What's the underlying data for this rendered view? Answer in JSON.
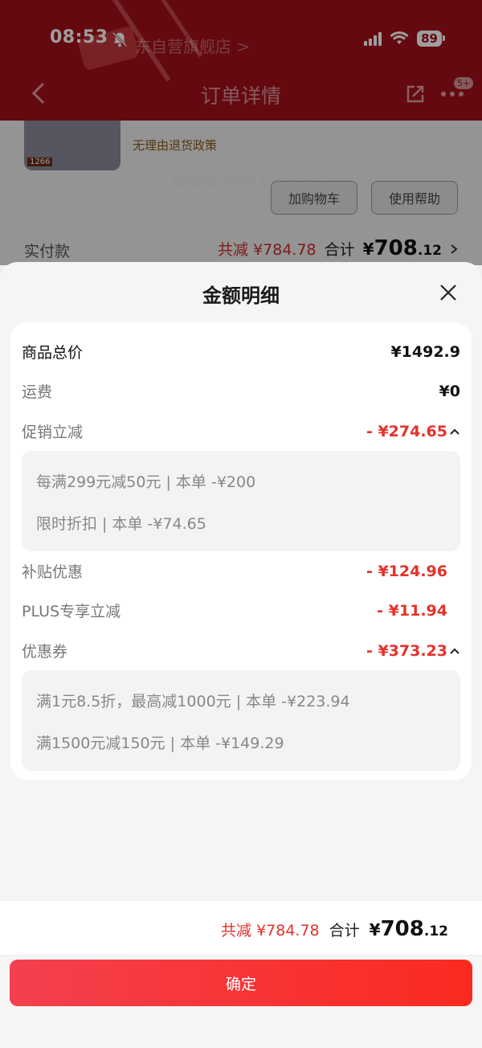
{
  "status_bar": {
    "time": "08:53",
    "battery": "89"
  },
  "header": {
    "store_name": "东自营旗舰店 >",
    "title": "订单详情",
    "badge": "5+"
  },
  "order": {
    "return_policy": "无理由退货政策",
    "watermark": "线报酷-new.xianbao.fun",
    "add_to_cart": "加购物车",
    "help": "使用帮助",
    "paid_label": "实付款",
    "reduced": "共减 ¥784.78",
    "total_label": "合计",
    "total_symbol": "¥",
    "total_int": "708",
    "total_dec": ".12",
    "product_label": "1266"
  },
  "sheet": {
    "title": "金额明细",
    "rows": {
      "goods_total": {
        "label": "商品总价",
        "value": "¥1492.9"
      },
      "shipping": {
        "label": "运费",
        "value": "¥0"
      },
      "promo": {
        "label": "促销立减",
        "value": "- ¥274.65"
      },
      "subsidy": {
        "label": "补贴优惠",
        "value": "- ¥124.96"
      },
      "plus": {
        "label": "PLUS专享立减",
        "value": "- ¥11.94"
      },
      "coupon": {
        "label": "优惠券",
        "value": "- ¥373.23"
      }
    },
    "promo_details": [
      "每满299元减50元 | 本单 -¥200",
      "限时折扣 | 本单 -¥74.65"
    ],
    "coupon_details": [
      "满1元8.5折，最高减1000元 | 本单 -¥223.94",
      "满1500元减150元 | 本单 -¥149.29"
    ],
    "footer": {
      "reduced": "共减 ¥784.78",
      "total_label": "合计",
      "total_symbol": "¥",
      "total_int": "708",
      "total_dec": ".12"
    },
    "confirm": "确定"
  },
  "colors": {
    "accent_red": "#e4322a",
    "header_red": "#a3101a"
  }
}
